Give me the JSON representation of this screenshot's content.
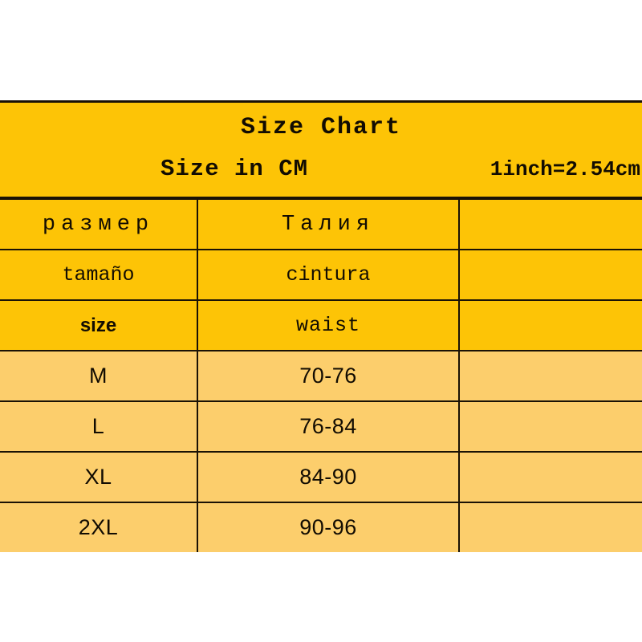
{
  "header": {
    "title": "Size  Chart",
    "unit_note": "Size in CM",
    "conversion_note": "1inch=2.54cm"
  },
  "colors": {
    "header_bg": "#FDC406",
    "data_bg": "#FCCE6C",
    "border": "#1a1205",
    "text": "#120c02",
    "page_bg": "#FFFFFF"
  },
  "table": {
    "language_rows": [
      {
        "size_label": "размер",
        "waist_label": "Талия",
        "extra_label": ""
      },
      {
        "size_label": "tamaño",
        "waist_label": "cintura",
        "extra_label": ""
      },
      {
        "size_label": "size",
        "waist_label": "waist",
        "extra_label": ""
      }
    ],
    "rows": [
      {
        "size": "M",
        "waist": "70-76",
        "extra": ""
      },
      {
        "size": "L",
        "waist": "76-84",
        "extra": ""
      },
      {
        "size": "XL",
        "waist": "84-90",
        "extra": ""
      },
      {
        "size": "2XL",
        "waist": "90-96",
        "extra": ""
      }
    ]
  },
  "chart_data": {
    "type": "table",
    "title": "Size  Chart",
    "subtitle": "Size in CM",
    "annotation": "1inch=2.54cm",
    "unit": "cm",
    "columns": [
      "size",
      "waist",
      ""
    ],
    "column_headers_by_language": {
      "ru": [
        "размер",
        "Талия",
        ""
      ],
      "es": [
        "tamaño",
        "cintura",
        ""
      ],
      "en": [
        "size",
        "waist",
        ""
      ]
    },
    "categories": [
      "M",
      "L",
      "XL",
      "2XL"
    ],
    "series": [
      {
        "name": "waist",
        "values": [
          "70-76",
          "76-84",
          "84-90",
          "90-96"
        ],
        "min_values": [
          70,
          76,
          84,
          90
        ],
        "max_values": [
          76,
          84,
          90,
          96
        ]
      }
    ]
  }
}
